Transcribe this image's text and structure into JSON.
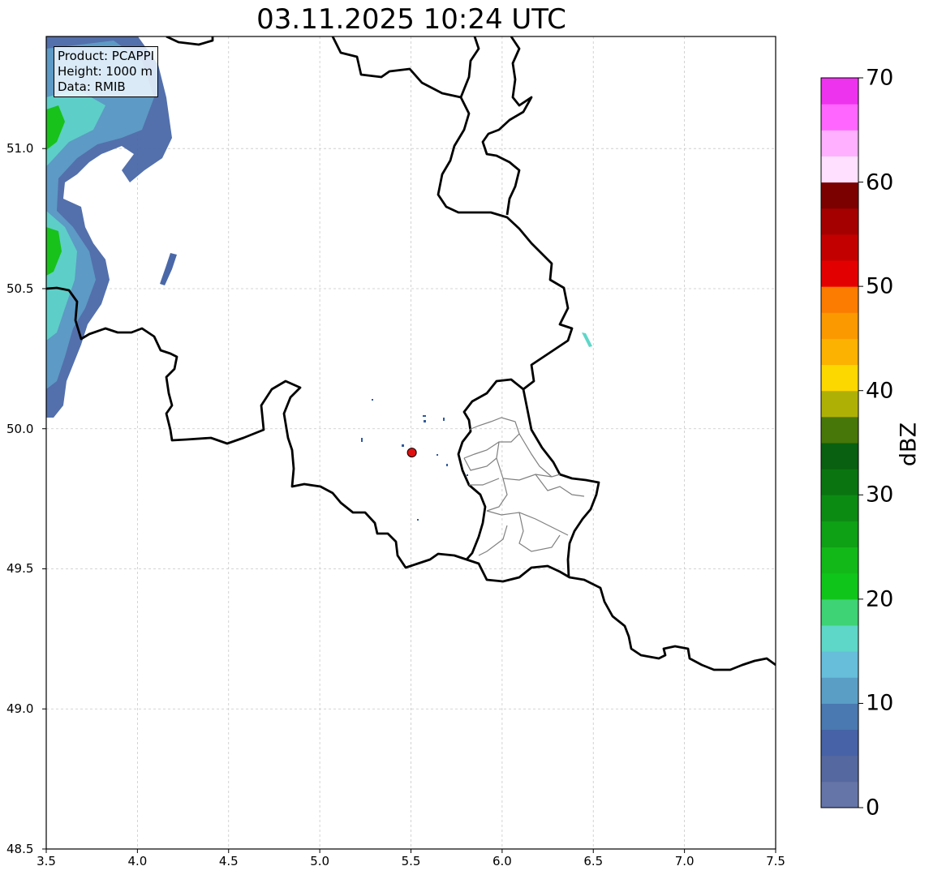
{
  "title": "03.11.2025 10:24 UTC",
  "info": {
    "product": "Product: PCAPPI",
    "height": "Height: 1000 m",
    "data": "Data: RMIB"
  },
  "axes": {
    "lon_range": [
      3.5,
      7.5
    ],
    "lat_range": [
      48.5,
      51.4
    ],
    "x_ticks": [
      "3.5",
      "4.0",
      "4.5",
      "5.0",
      "5.5",
      "6.0",
      "6.5",
      "7.0",
      "7.5"
    ],
    "y_ticks": [
      "48.5",
      "49.0",
      "49.5",
      "50.0",
      "50.5",
      "51.0"
    ],
    "grid": true
  },
  "radar_site": {
    "lon": 5.505,
    "lat": 49.915,
    "color": "#e01010"
  },
  "colorbar": {
    "label": "dBZ",
    "min": 0,
    "max": 70,
    "ticks": [
      "0",
      "10",
      "20",
      "30",
      "40",
      "50",
      "60",
      "70"
    ],
    "colors": [
      "#6675a8",
      "#55689f",
      "#4762a6",
      "#4a78b0",
      "#5a9ec6",
      "#66bedb",
      "#5ed7c8",
      "#3ed374",
      "#10c51a",
      "#12b818",
      "#0ea015",
      "#0c8b13",
      "#0a7510",
      "#096010",
      "#477708",
      "#afb006",
      "#fdd700",
      "#fbb200",
      "#fb9900",
      "#fb7c00",
      "#e30000",
      "#c30000",
      "#a40000",
      "#7b0000",
      "#ffe0ff",
      "#ffb0ff",
      "#ff66ff",
      "#ee33ee"
    ]
  },
  "echo_colors": {
    "weak": "#4a68a8",
    "light": "#5e9fc8",
    "cyan": "#5ed7c8",
    "green": "#18c21a"
  }
}
